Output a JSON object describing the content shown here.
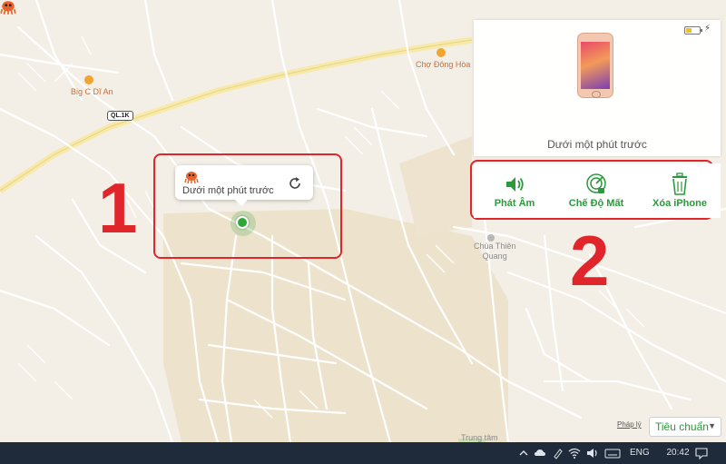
{
  "map": {
    "pois": {
      "big_c": "Big C Dĩ An",
      "cho_dong_hoa": "Chợ Đông Hòa",
      "chua_thien_quang_line1": "Chùa Thiên",
      "chua_thien_quang_line2": "Quang",
      "trung_tam": "Trung tâm"
    },
    "road_shield": "QL.1K",
    "colors": {
      "background": "#f3efe6",
      "road": "#ffffff",
      "highway": "#f7e9a8",
      "urban_area": "#ede2cc"
    }
  },
  "device_callout": {
    "status": "Dưới một phút trước",
    "icon": "refresh-icon",
    "emoji_icon": "octopus-emoji-icon"
  },
  "annotations": {
    "label1": "1",
    "label2": "2",
    "color": "#e0262b"
  },
  "device_panel": {
    "battery_level": 0.45,
    "battery_color": "#f2c21b",
    "device_image": "iphone-image",
    "status": "Dưới một phút trước",
    "actions": [
      {
        "label": "Phát Âm",
        "icon": "speaker-icon"
      },
      {
        "label": "Chế Độ Mất",
        "icon": "lost-mode-icon"
      },
      {
        "label": "Xóa iPhone",
        "icon": "trash-icon"
      }
    ],
    "accent_color": "#2a9a3a"
  },
  "map_controls": {
    "legal_link": "Pháp lý",
    "map_type": "Tiêu chuẩn"
  },
  "taskbar": {
    "language": "ENG",
    "time": "20:42"
  }
}
